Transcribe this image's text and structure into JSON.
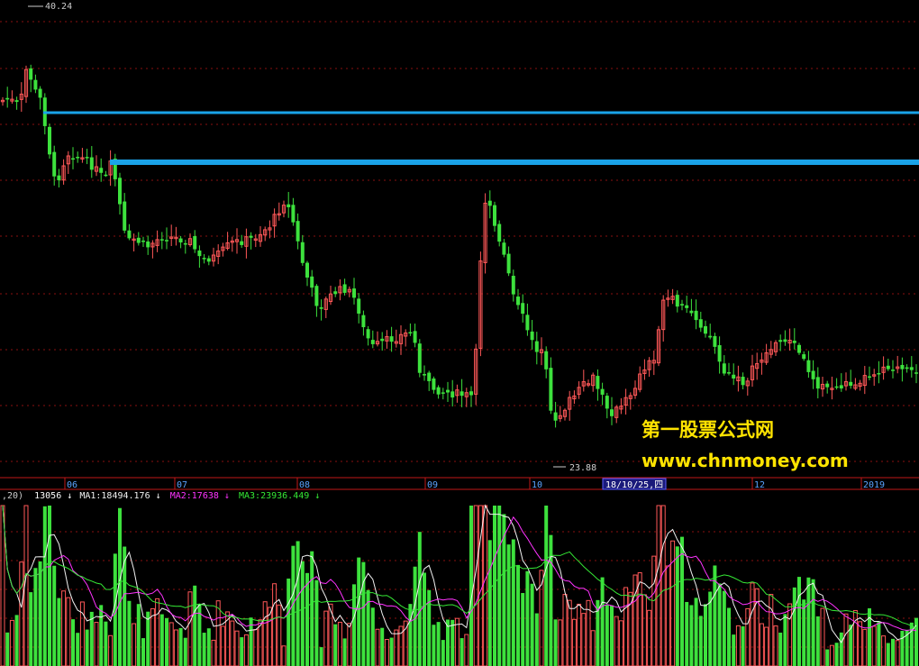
{
  "colors": {
    "background": "#000000",
    "up": "#ff5858",
    "down": "#3de13d",
    "resistance": "#1aa3e8",
    "grid": "#8a1010",
    "axis": "#c01818",
    "text": "#cccccc",
    "month": "#5aa3ff",
    "ma1": "#f2f2f2",
    "ma2": "#ff33ff",
    "ma3": "#35e835",
    "watermark": "#ffe400"
  },
  "price_panel": {
    "high_label": "40.24",
    "low_label": "23.88"
  },
  "axis": {
    "months": [
      "06",
      "07",
      "08",
      "09",
      "10",
      "12",
      "2019"
    ],
    "cursor_date": "18/10/25,四"
  },
  "volume_header": {
    "param": ",20)",
    "value": "13056",
    "value_arrow": "↓",
    "ma1": "MA1:18494.176",
    "ma1_arrow": "↓",
    "ma2": "MA2:17638",
    "ma2_arrow": "↓",
    "ma3": "MA3:23936.449",
    "ma3_arrow": "↓"
  },
  "watermark": {
    "line1": "第一股票公式网",
    "line2": "www.chnmoney.com"
  },
  "chart_data": {
    "type": "candlestick",
    "high": 40.24,
    "low": 23.88,
    "resistance_lines": 2,
    "volume_ma": {
      "MA1": 18494.176,
      "MA2": 17638,
      "MA3": 23936.449
    },
    "volume_last": 13056
  }
}
